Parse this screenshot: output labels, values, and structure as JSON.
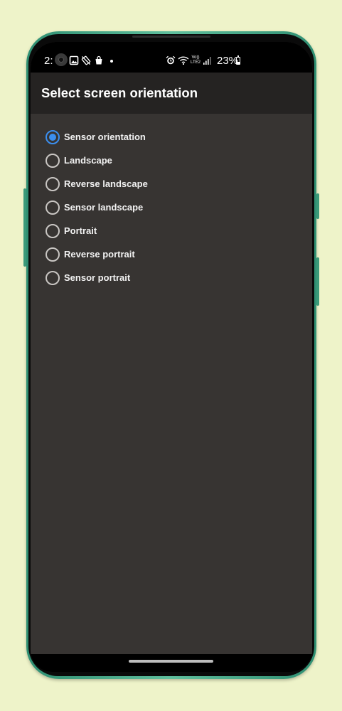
{
  "status_bar": {
    "time": "2:",
    "volte_top": "Vo))",
    "volte_bottom": "LTE2",
    "battery_percent": "23%",
    "icons": [
      "camera-cutout-icon",
      "gallery-icon",
      "rotate-off-icon",
      "bag-icon",
      "dot-icon",
      "alarm-icon",
      "wifi-icon",
      "volte-icon",
      "signal-icon",
      "battery-icon"
    ]
  },
  "dialog": {
    "title": "Select screen orientation",
    "options": [
      {
        "label": "Sensor orientation",
        "selected": true
      },
      {
        "label": "Landscape",
        "selected": false
      },
      {
        "label": "Reverse landscape",
        "selected": false
      },
      {
        "label": "Sensor landscape",
        "selected": false
      },
      {
        "label": "Portrait",
        "selected": false
      },
      {
        "label": "Reverse portrait",
        "selected": false
      },
      {
        "label": "Sensor portrait",
        "selected": false
      }
    ]
  },
  "colors": {
    "accent": "#3b8ff0",
    "background": "#373432",
    "titlebar": "#252322",
    "page_background": "#eef3c9",
    "phone_frame": "#3b9a7a"
  }
}
